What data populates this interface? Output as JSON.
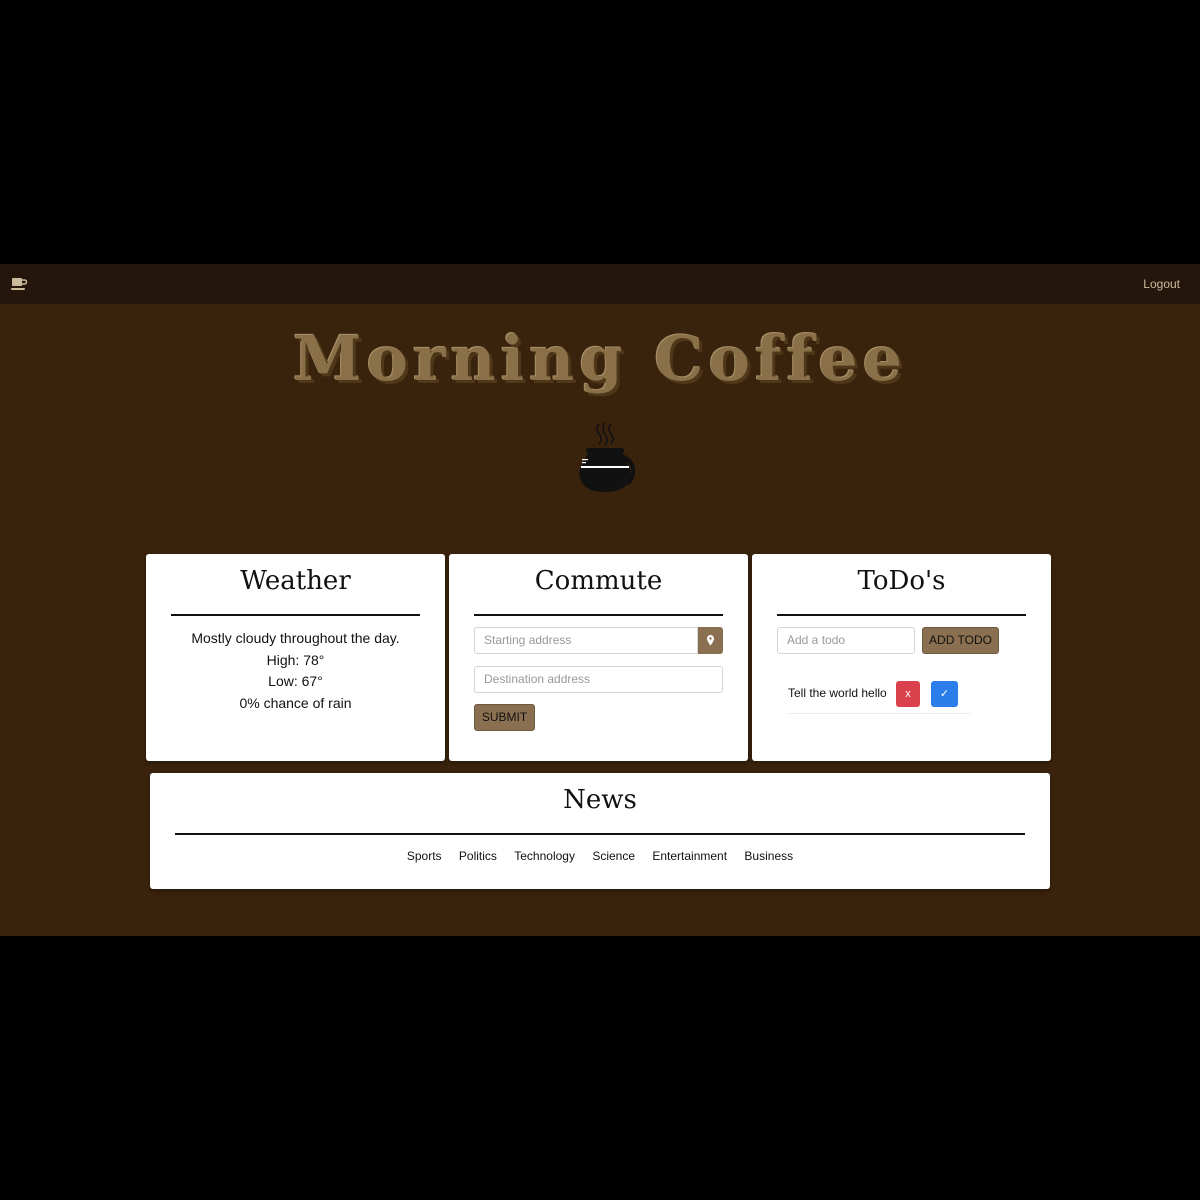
{
  "navbar": {
    "brand_icon": "coffee-cup-icon",
    "logout_label": "Logout"
  },
  "hero": {
    "title": "Morning Coffee",
    "icon": "coffee-pot-icon"
  },
  "weather": {
    "title": "Weather",
    "summary": "Mostly cloudy throughout the day.",
    "high": "High: 78°",
    "low": "Low: 67°",
    "rain": "0% chance of rain"
  },
  "commute": {
    "title": "Commute",
    "start_placeholder": "Starting address",
    "dest_placeholder": "Destination address",
    "location_icon": "map-pin-icon",
    "submit_label": "SUBMIT"
  },
  "todos": {
    "title": "ToDo's",
    "input_placeholder": "Add a todo",
    "add_label": "ADD TODO",
    "items": [
      {
        "text": "Tell the world hello",
        "delete_label": "x",
        "done_label": "✓"
      }
    ]
  },
  "news": {
    "title": "News",
    "categories": [
      "Sports",
      "Politics",
      "Technology",
      "Science",
      "Entertainment",
      "Business"
    ]
  },
  "colors": {
    "page_bg": "#3a230d",
    "navbar_bg": "#24160b",
    "accent": "#8a7050",
    "danger": "#d9414d",
    "primary": "#2b7de9"
  }
}
